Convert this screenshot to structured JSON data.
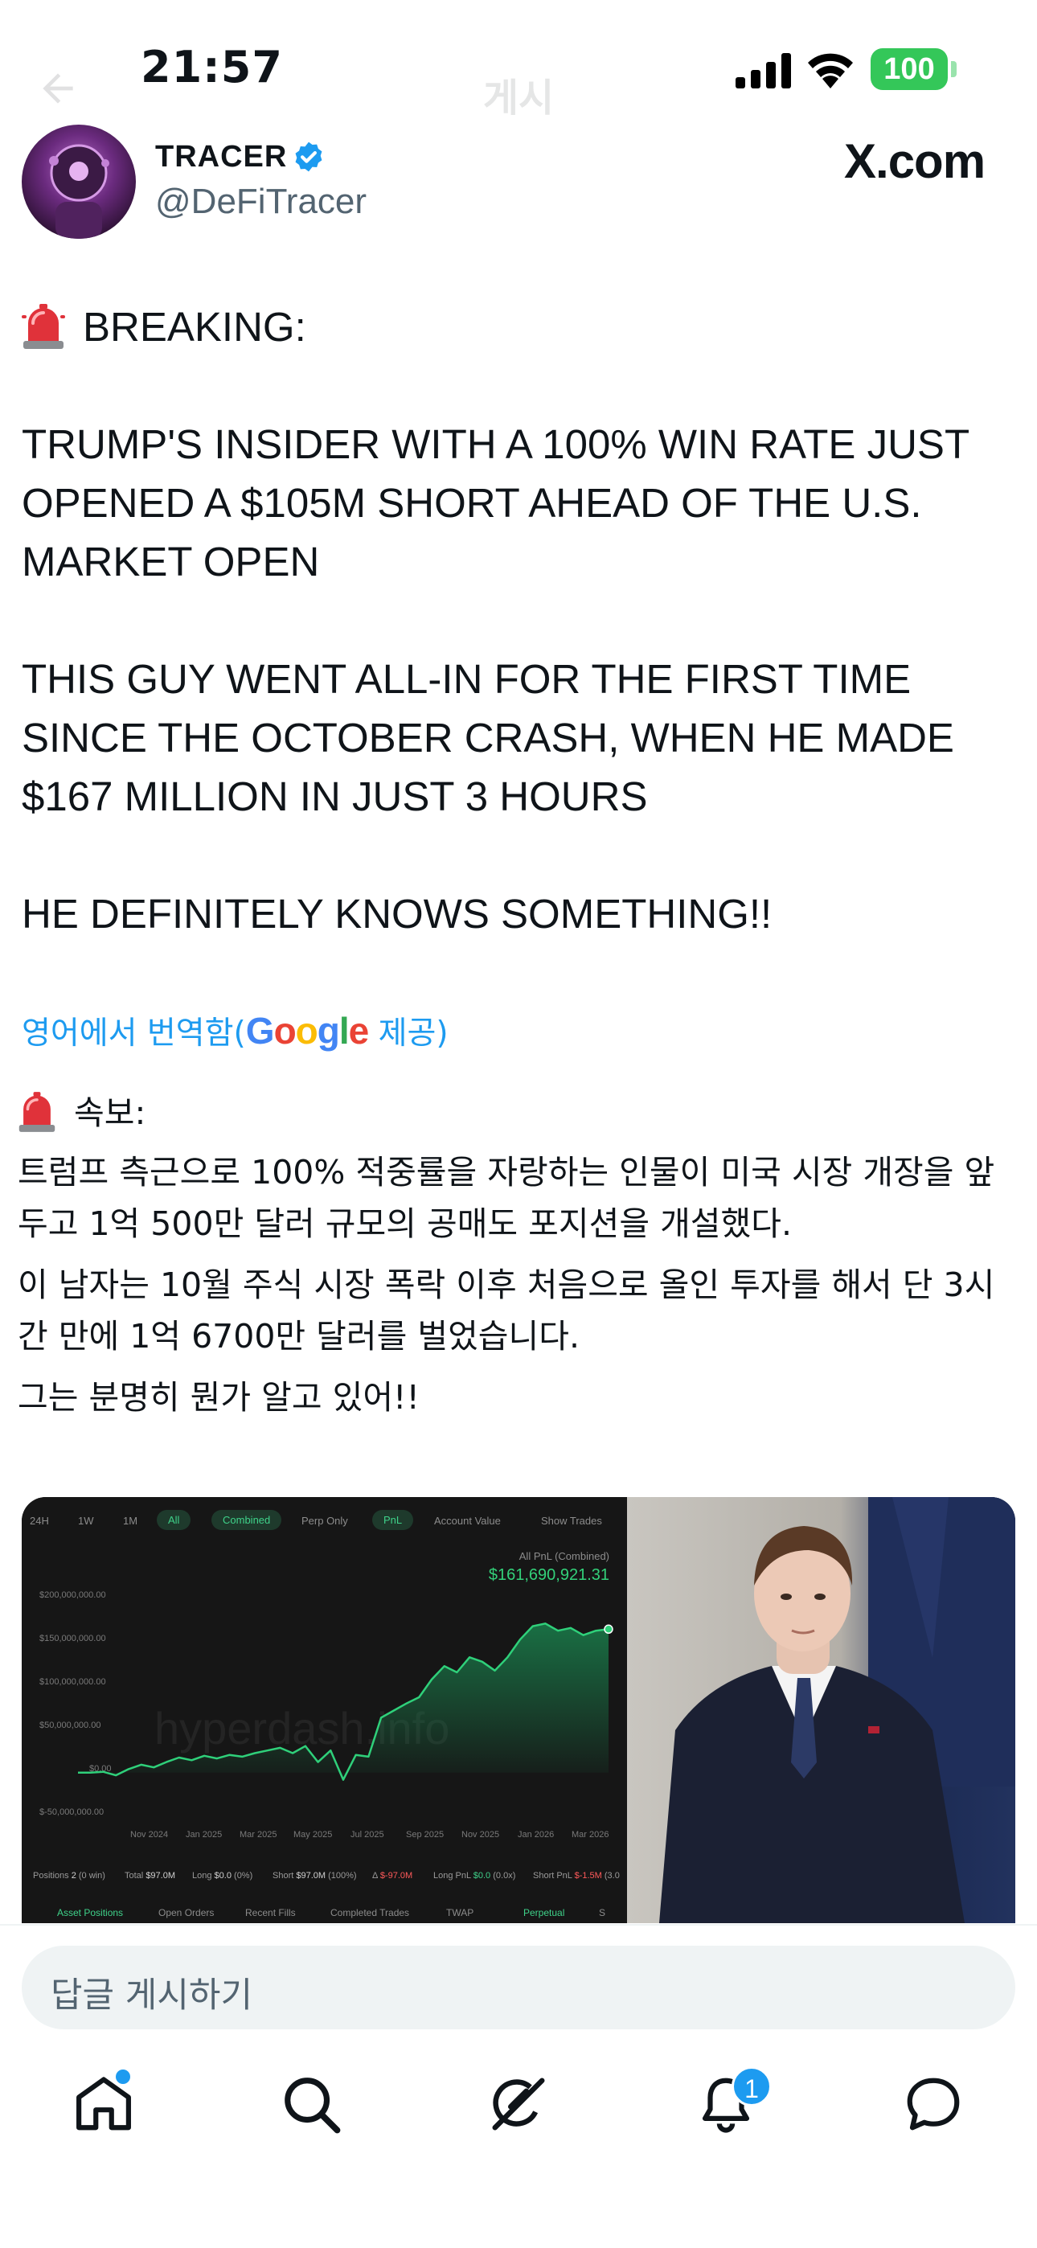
{
  "status_bar": {
    "time": "21:57",
    "battery": "100",
    "ghost_title": "게시"
  },
  "author": {
    "name": "TRACER",
    "handle": "@DeFiTracer",
    "brand": "X.com"
  },
  "post": {
    "breaking": "BREAKING:",
    "line1": "TRUMP'S INSIDER WITH A 100% WIN RATE JUST OPENED A $105M SHORT AHEAD OF THE U.S. MARKET OPEN",
    "line2": "THIS GUY WENT ALL-IN FOR THE FIRST TIME SINCE THE OCTOBER CRASH, WHEN HE MADE $167 MILLION IN JUST 3 HOURS",
    "line3": "HE DEFINITELY KNOWS SOMETHING!!"
  },
  "translation": {
    "label_prefix": "영어에서 번역함(",
    "label_brand": "Google",
    "label_suffix": " 제공)",
    "head": "속보:",
    "p1": "트럼프 측근으로 100% 적중률을 자랑하는 인물이 미국 시장 개장을 앞두고 1억 500만 달러 규모의 공매도 포지션을 개설했다.",
    "p2": "이 남자는 10월 주식 시장 폭락 이후 처음으로 올인 투자를 해서 단 3시간 만에 1억 6700만 달러를 벌었습니다.",
    "p3": "그는 분명히 뭔가 알고 있어!!"
  },
  "media": {
    "tabs": [
      "24H",
      "1W",
      "1M",
      "All",
      "Combined",
      "Perp Only",
      "PnL",
      "Account Value",
      "Show Trades"
    ],
    "pnl_label": "All PnL (Combined)",
    "pnl_value": "$161,690,921.31",
    "watermark": "hyperdash.info",
    "stats": {
      "positions": "Positions",
      "positions_val": "2",
      "positions_note": "(0 win)",
      "total": "Total",
      "total_val": "$97.0M",
      "long": "Long",
      "long_val": "$0.0",
      "long_pct": "(0%)",
      "short": "Short",
      "short_val": "$97.0M",
      "short_pct": "(100%)",
      "delta": "Δ",
      "delta_val": "$-97.0M",
      "long_pnl": "Long PnL",
      "long_pnl_val": "$0.0",
      "long_pnl_x": "(0.0x)",
      "short_pnl": "Short PnL",
      "short_pnl_val": "$-1.5M",
      "short_pnl_x": "(3.0"
    },
    "bottom_tabs": [
      "Asset Positions",
      "Open Orders",
      "Recent Fills",
      "Completed Trades",
      "TWAP",
      "Perpetual",
      "S"
    ]
  },
  "chart_data": {
    "type": "area",
    "title": "All PnL (Combined)",
    "xlabel": "",
    "ylabel": "",
    "x_ticks": [
      "Nov 2024",
      "Jan 2025",
      "Mar 2025",
      "May 2025",
      "Jul 2025",
      "Sep 2025",
      "Nov 2025",
      "Jan 2026",
      "Mar 2026"
    ],
    "y_ticks": [
      "$200,000,000.00",
      "$150,000,000.00",
      "$100,000,000.00",
      "$50,000,000.00",
      "$0.00",
      "$-50,000,000.00"
    ],
    "ylim": [
      -50000000,
      200000000
    ],
    "series": [
      {
        "x": [
          0,
          0.4,
          0.8,
          1.2,
          1.6,
          2.0,
          2.4,
          2.8,
          3.2,
          3.6,
          4.0,
          4.4,
          4.8,
          5.2,
          5.6,
          6.0,
          6.4,
          6.8,
          7.2,
          7.6,
          8.0,
          8.4,
          8.8,
          9.2,
          9.6,
          10.0,
          10.4,
          10.8,
          11.2,
          11.6,
          12.0,
          12.4,
          12.8,
          13.2,
          13.6,
          14.0,
          14.4,
          14.8,
          15.2,
          15.6,
          16.0,
          16.4,
          16.8
        ],
        "values": [
          0,
          0,
          1000000,
          -3000000,
          4000000,
          9000000,
          6000000,
          12000000,
          17000000,
          14000000,
          19000000,
          16000000,
          20000000,
          18000000,
          22000000,
          25000000,
          28000000,
          22000000,
          30000000,
          12000000,
          25000000,
          -8000000,
          20000000,
          18000000,
          62000000,
          70000000,
          78000000,
          85000000,
          105000000,
          120000000,
          113000000,
          130000000,
          125000000,
          115000000,
          130000000,
          150000000,
          165000000,
          168000000,
          160000000,
          163000000,
          155000000,
          160000000,
          161690921
        ]
      }
    ],
    "grid": false,
    "colors": {
      "line": "#2fd07a",
      "fill": "#1a7f4c"
    }
  },
  "reply": {
    "placeholder": "답글 게시하기"
  },
  "nav": {
    "notifications_badge": "1"
  }
}
